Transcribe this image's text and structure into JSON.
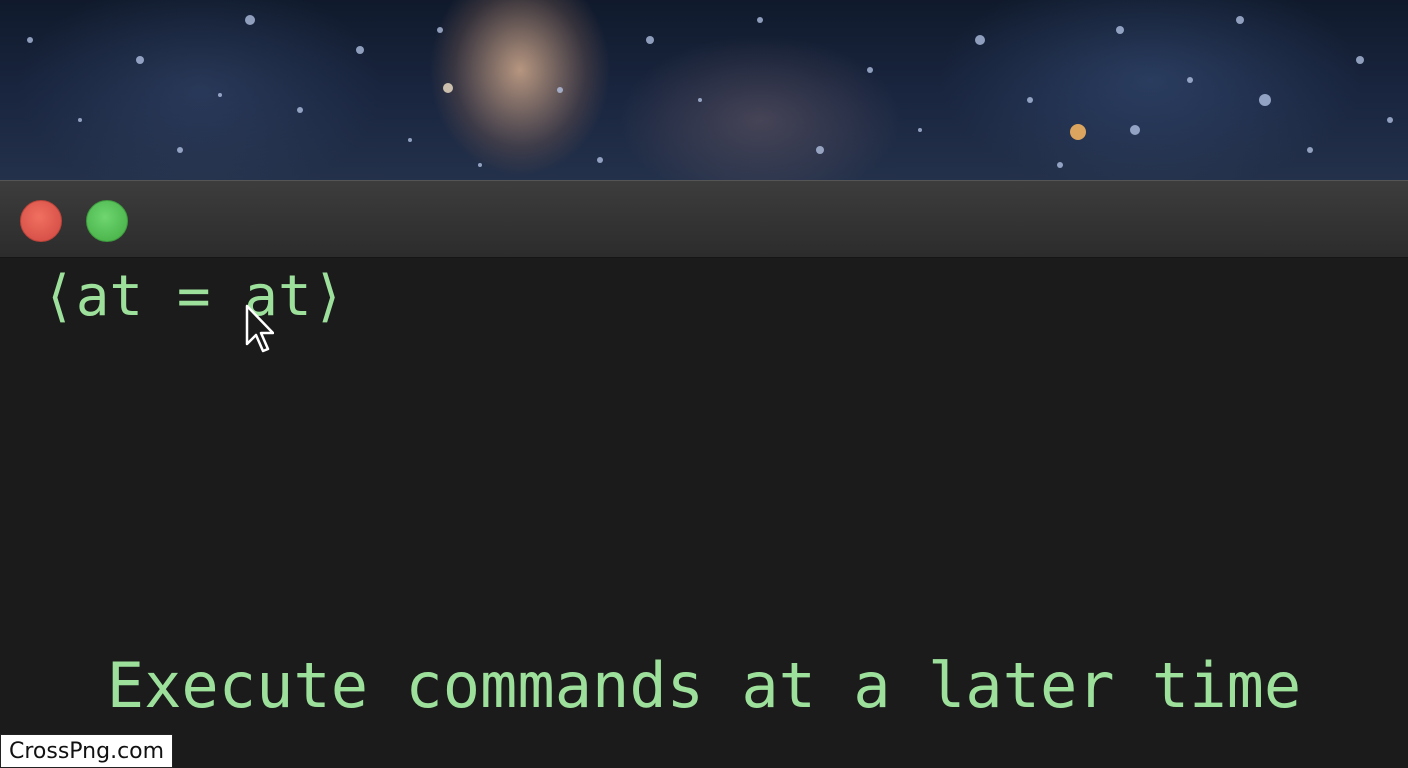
{
  "background": {
    "image": "starry-night-sky-photo"
  },
  "window": {
    "controls": {
      "close_color": "#e0584c",
      "zoom_color": "#56c356"
    }
  },
  "terminal": {
    "command_line": "⟨at = at⟩",
    "text_color": "#9de09b",
    "caption": "Execute commands at a later time"
  },
  "watermark": {
    "text": "CrossPng.com"
  }
}
